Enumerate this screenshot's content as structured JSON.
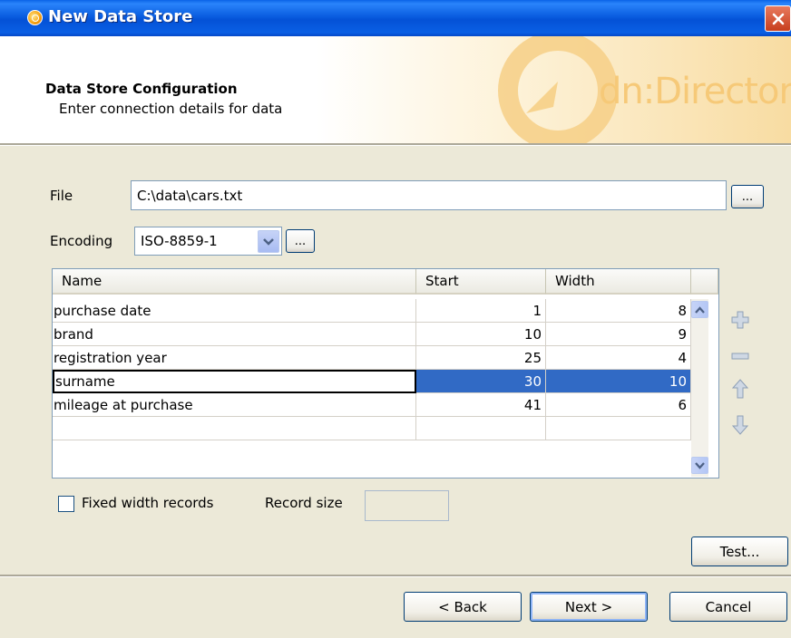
{
  "window": {
    "title": "New Data Store"
  },
  "header": {
    "title": "Data Store Configuration",
    "subtitle": "Enter connection details for data",
    "logo_text": "dn:Director"
  },
  "form": {
    "file_label": "File",
    "file_value": "C:\\data\\cars.txt",
    "browse_label": "...",
    "encoding_label": "Encoding",
    "encoding_value": "ISO-8859-1"
  },
  "table": {
    "columns": [
      "Name",
      "Start",
      "Width"
    ],
    "rows": [
      {
        "name": "purchase date",
        "start": "1",
        "width": "8"
      },
      {
        "name": "brand",
        "start": "10",
        "width": "9"
      },
      {
        "name": "registration year",
        "start": "25",
        "width": "4"
      },
      {
        "name": "surname",
        "start": "30",
        "width": "10"
      },
      {
        "name": "mileage at purchase",
        "start": "41",
        "width": "6"
      },
      {
        "name": "",
        "start": "",
        "width": ""
      }
    ]
  },
  "options": {
    "fixed_width_label": "Fixed width records",
    "record_size_label": "Record size"
  },
  "buttons": {
    "test": "Test...",
    "back": "< Back",
    "next": "Next >",
    "cancel": "Cancel"
  },
  "colors": {
    "titlebar": "#0a5de0",
    "selection": "#316ac5",
    "close": "#c73e1d"
  }
}
